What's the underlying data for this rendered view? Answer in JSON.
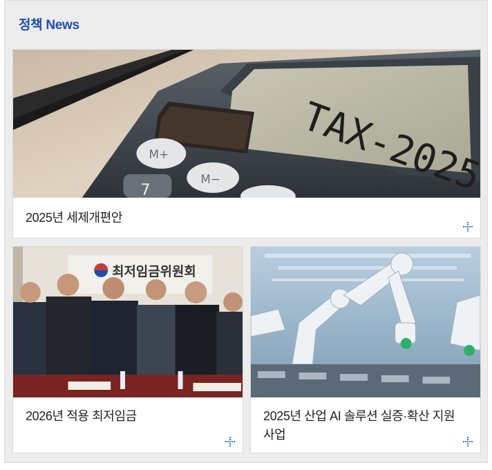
{
  "section": {
    "title": "정책 News"
  },
  "cards": [
    {
      "caption": "2025년 세제개편안",
      "image": {
        "subject": "calculator-with-display",
        "display_text": "TAX-2025",
        "keys": [
          "M+",
          "M−",
          "7"
        ]
      }
    },
    {
      "caption": "2026년 적용 최저임금",
      "image": {
        "subject": "group-photo-committee",
        "banner_text": "최저임금위원회"
      }
    },
    {
      "caption": "2025년 산업 AI 솔루션 실증·확산 지원 사업",
      "image": {
        "subject": "robotic-arms-factory"
      }
    }
  ],
  "icons": {
    "more": "plus-dots-icon"
  },
  "colors": {
    "title": "#1f4fa8",
    "more_icon": "#3a78c9",
    "panel": "#ececec"
  }
}
